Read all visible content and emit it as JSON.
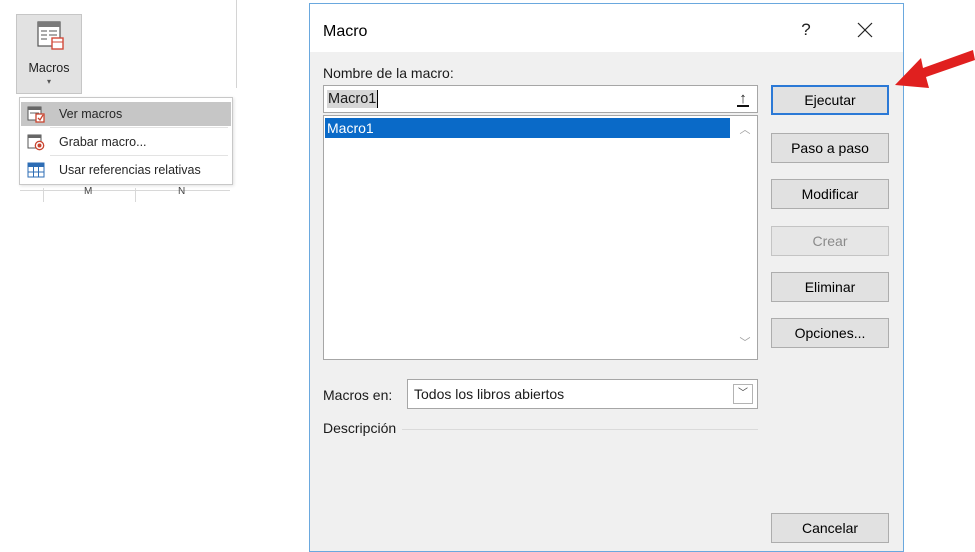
{
  "ribbon": {
    "macros_button_label": "Macros",
    "macros_button_caret": "▾",
    "column_letters": [
      "M",
      "N"
    ],
    "menu": [
      {
        "label": "Ver macros",
        "icon": "view-macros-icon",
        "highlighted": true
      },
      {
        "label": "Grabar macro...",
        "icon": "record-macro-icon",
        "highlighted": false
      },
      {
        "label": "Usar referencias relativas",
        "icon": "relative-references-icon",
        "highlighted": false
      }
    ]
  },
  "dialog": {
    "title": "Macro",
    "help_label": "?",
    "name_label": "Nombre de la macro:",
    "name_value": "Macro1",
    "upload_label": "↑",
    "list_items": [
      "Macro1"
    ],
    "selected_item": "Macro1",
    "macros_in_label": "Macros en:",
    "macros_in_value": "Todos los libros abiertos",
    "description_label": "Descripción",
    "buttons": {
      "run": "Ejecutar",
      "step": "Paso a paso",
      "edit": "Modificar",
      "create": "Crear",
      "delete": "Eliminar",
      "options": "Opciones...",
      "cancel": "Cancelar"
    },
    "create_disabled": true
  },
  "colors": {
    "dialog_bg": "#f0f0f0",
    "selection": "#0a6ac8",
    "primary_border": "#2b79d6",
    "annotation_arrow": "#e0201f"
  }
}
